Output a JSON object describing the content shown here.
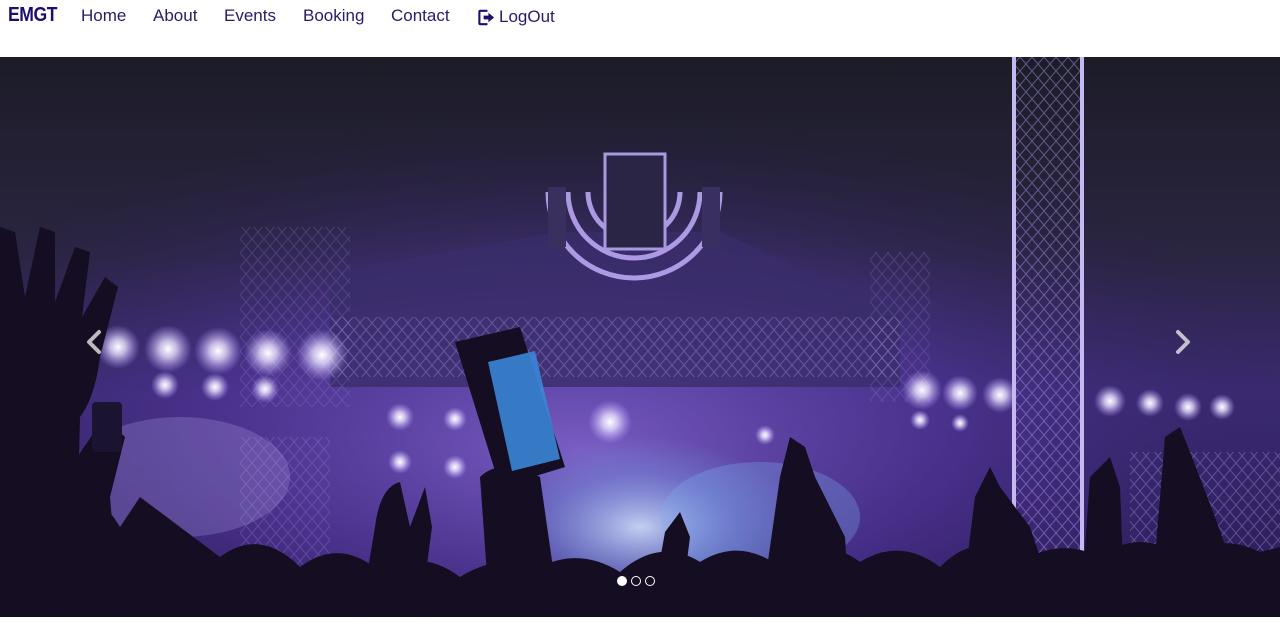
{
  "brand": {
    "text": "EMGT"
  },
  "nav": {
    "home": "Home",
    "about": "About",
    "events": "Events",
    "booking": "Booking",
    "contact": "Contact",
    "logout": "LogOut"
  },
  "carousel": {
    "indicator_count": 3,
    "active_index": 0,
    "prev_icon": "chevron-left-icon",
    "next_icon": "chevron-right-icon"
  },
  "colors": {
    "brand": "#1a0f6e",
    "nav_text": "#2a1a6a",
    "stage_purple": "#7b4fd6"
  }
}
